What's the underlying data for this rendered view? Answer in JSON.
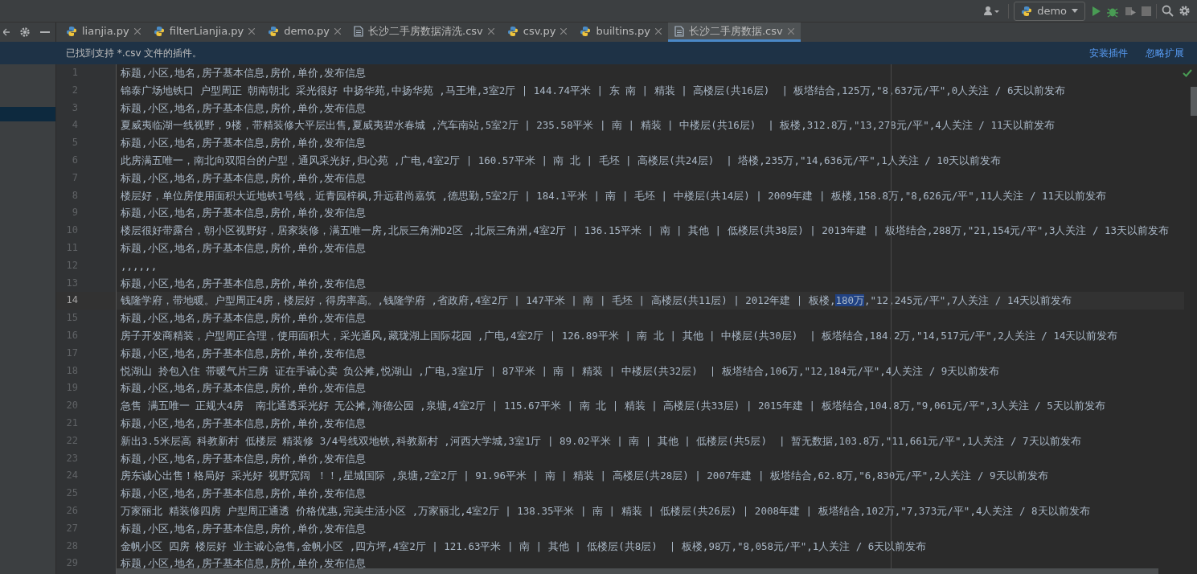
{
  "toolbar": {
    "run_config": "demo"
  },
  "tabs": [
    {
      "label": "lianjia.py",
      "kind": "python",
      "selected": false
    },
    {
      "label": "filterLianjia.py",
      "kind": "python",
      "selected": false
    },
    {
      "label": "demo.py",
      "kind": "python",
      "selected": false
    },
    {
      "label": "长沙二手房数据清洗.csv",
      "kind": "text",
      "selected": false
    },
    {
      "label": "csv.py",
      "kind": "python",
      "selected": false
    },
    {
      "label": "builtins.py",
      "kind": "python",
      "selected": false
    },
    {
      "label": "长沙二手房数据.csv",
      "kind": "text",
      "selected": true
    }
  ],
  "notification": {
    "message": "已找到支持 *.csv 文件的插件。",
    "actions": [
      "安装插件",
      "忽略扩展"
    ]
  },
  "editor": {
    "lines": [
      {
        "number": "1",
        "current": false,
        "segments": [
          {
            "text": "标题,小区,地名,房子基本信息,房价,单价,发布信息",
            "selected": false
          }
        ]
      },
      {
        "number": "2",
        "current": false,
        "segments": [
          {
            "text": "锦泰广场地铁口 户型周正 朝南朝北 采光很好 中扬华苑,中扬华苑 ,马王堆,3室2厅 | 144.74平米 | 东 南 | 精装 | 高楼层(共16层)  | 板塔结合,125万,\"8,637元/平\",0人关注 / 6天以前发布",
            "selected": false
          }
        ]
      },
      {
        "number": "3",
        "current": false,
        "segments": [
          {
            "text": "标题,小区,地名,房子基本信息,房价,单价,发布信息",
            "selected": false
          }
        ]
      },
      {
        "number": "4",
        "current": false,
        "segments": [
          {
            "text": "夏威夷临湖一线视野，9楼，带精装修大平层出售,夏威夷碧水春城 ,汽车南站,5室2厅 | 235.58平米 | 南 | 精装 | 中楼层(共16层)  | 板楼,312.8万,\"13,278元/平\",4人关注 / 11天以前发布",
            "selected": false
          }
        ]
      },
      {
        "number": "5",
        "current": false,
        "segments": [
          {
            "text": "标题,小区,地名,房子基本信息,房价,单价,发布信息",
            "selected": false
          }
        ]
      },
      {
        "number": "6",
        "current": false,
        "segments": [
          {
            "text": "此房满五唯一，南北向双阳台的户型，通风采光好,归心苑 ,广电,4室2厅 | 160.57平米 | 南 北 | 毛坯 | 高楼层(共24层)  | 塔楼,235万,\"14,636元/平\",1人关注 / 10天以前发布",
            "selected": false
          }
        ]
      },
      {
        "number": "7",
        "current": false,
        "segments": [
          {
            "text": "标题,小区,地名,房子基本信息,房价,单价,发布信息",
            "selected": false
          }
        ]
      },
      {
        "number": "8",
        "current": false,
        "segments": [
          {
            "text": "楼层好，单位房使用面积大近地铁1号线，近青园梓枫,升远君尚嘉筑 ,德思勤,5室2厅 | 184.1平米 | 南 | 毛坯 | 中楼层(共14层) | 2009年建 | 板楼,158.8万,\"8,626元/平\",11人关注 / 11天以前发布",
            "selected": false
          }
        ]
      },
      {
        "number": "9",
        "current": false,
        "segments": [
          {
            "text": "标题,小区,地名,房子基本信息,房价,单价,发布信息",
            "selected": false
          }
        ]
      },
      {
        "number": "10",
        "current": false,
        "segments": [
          {
            "text": "楼层很好带露台，朝小区视野好，居家装修，满五唯一房,北辰三角洲D2区 ,北辰三角洲,4室2厅 | 136.15平米 | 南 | 其他 | 低楼层(共38层) | 2013年建 | 板塔结合,288万,\"21,154元/平\",3人关注 / 13天以前发布",
            "selected": false
          }
        ]
      },
      {
        "number": "11",
        "current": false,
        "segments": [
          {
            "text": "标题,小区,地名,房子基本信息,房价,单价,发布信息",
            "selected": false
          }
        ]
      },
      {
        "number": "12",
        "current": false,
        "segments": [
          {
            "text": ",,,,,,",
            "selected": false
          }
        ]
      },
      {
        "number": "13",
        "current": false,
        "segments": [
          {
            "text": "标题,小区,地名,房子基本信息,房价,单价,发布信息",
            "selected": false
          }
        ]
      },
      {
        "number": "14",
        "current": true,
        "segments": [
          {
            "text": "钱隆学府，带地暖。户型周正4房，楼层好，得房率高。,钱隆学府 ,省政府,4室2厅 | 147平米 | 南 | 毛坯 | 高楼层(共11层) | 2012年建 | 板楼,",
            "selected": false
          },
          {
            "text": "180万",
            "selected": true
          },
          {
            "text": ",\"12,245元/平\",7人关注 / 14天以前发布",
            "selected": false
          }
        ]
      },
      {
        "number": "15",
        "current": false,
        "segments": [
          {
            "text": "标题,小区,地名,房子基本信息,房价,单价,发布信息",
            "selected": false
          }
        ]
      },
      {
        "number": "16",
        "current": false,
        "segments": [
          {
            "text": "房子开发商精装，户型周正合理，使用面积大，采光通风,藏珑湖上国际花园 ,广电,4室2厅 | 126.89平米 | 南 北 | 其他 | 中楼层(共30层)  | 板塔结合,184.2万,\"14,517元/平\",2人关注 / 14天以前发布",
            "selected": false
          }
        ]
      },
      {
        "number": "17",
        "current": false,
        "segments": [
          {
            "text": "标题,小区,地名,房子基本信息,房价,单价,发布信息",
            "selected": false
          }
        ]
      },
      {
        "number": "18",
        "current": false,
        "segments": [
          {
            "text": "悦湖山 拎包入住 带暖气片三房 证在手诚心卖 负公摊,悦湖山 ,广电,3室1厅 | 87平米 | 南 | 精装 | 中楼层(共32层)  | 板塔结合,106万,\"12,184元/平\",4人关注 / 9天以前发布",
            "selected": false
          }
        ]
      },
      {
        "number": "19",
        "current": false,
        "segments": [
          {
            "text": "标题,小区,地名,房子基本信息,房价,单价,发布信息",
            "selected": false
          }
        ]
      },
      {
        "number": "20",
        "current": false,
        "segments": [
          {
            "text": "急售 满五唯一 正规大4房  南北通透采光好 无公摊,海德公园 ,泉塘,4室2厅 | 115.67平米 | 南 北 | 精装 | 高楼层(共33层) | 2015年建 | 板塔结合,104.8万,\"9,061元/平\",3人关注 / 5天以前发布",
            "selected": false
          }
        ]
      },
      {
        "number": "21",
        "current": false,
        "segments": [
          {
            "text": "标题,小区,地名,房子基本信息,房价,单价,发布信息",
            "selected": false
          }
        ]
      },
      {
        "number": "22",
        "current": false,
        "segments": [
          {
            "text": "新出3.5米层高 科教新村 低楼层 精装修 3/4号线双地铁,科教新村 ,河西大学城,3室1厅 | 89.02平米 | 南 | 其他 | 低楼层(共5层)  | 暂无数据,103.8万,\"11,661元/平\",1人关注 / 7天以前发布",
            "selected": false
          }
        ]
      },
      {
        "number": "23",
        "current": false,
        "segments": [
          {
            "text": "标题,小区,地名,房子基本信息,房价,单价,发布信息",
            "selected": false
          }
        ]
      },
      {
        "number": "24",
        "current": false,
        "segments": [
          {
            "text": "房东诚心出售！格局好 采光好 视野宽阔 ！！,星城国际 ,泉塘,2室2厅 | 91.96平米 | 南 | 精装 | 高楼层(共28层) | 2007年建 | 板塔结合,62.8万,\"6,830元/平\",2人关注 / 9天以前发布",
            "selected": false
          }
        ]
      },
      {
        "number": "25",
        "current": false,
        "segments": [
          {
            "text": "标题,小区,地名,房子基本信息,房价,单价,发布信息",
            "selected": false
          }
        ]
      },
      {
        "number": "26",
        "current": false,
        "segments": [
          {
            "text": "万家丽北 精装修四房 户型周正通透 价格优惠,完美生活小区 ,万家丽北,4室2厅 | 138.35平米 | 南 | 精装 | 低楼层(共26层) | 2008年建 | 板塔结合,102万,\"7,373元/平\",4人关注 / 8天以前发布",
            "selected": false
          }
        ]
      },
      {
        "number": "27",
        "current": false,
        "segments": [
          {
            "text": "标题,小区,地名,房子基本信息,房价,单价,发布信息",
            "selected": false
          }
        ]
      },
      {
        "number": "28",
        "current": false,
        "segments": [
          {
            "text": "金帆小区 四房 楼层好 业主诚心急售,金帆小区 ,四方坪,4室2厅 | 121.63平米 | 南 | 其他 | 低楼层(共8层)  | 板楼,98万,\"8,058元/平\",1人关注 / 6天以前发布",
            "selected": false
          }
        ]
      },
      {
        "number": "29",
        "current": false,
        "segments": [
          {
            "text": "标题,小区,地名,房子基本信息,房价,单价,发布信息",
            "selected": false
          }
        ]
      }
    ]
  }
}
